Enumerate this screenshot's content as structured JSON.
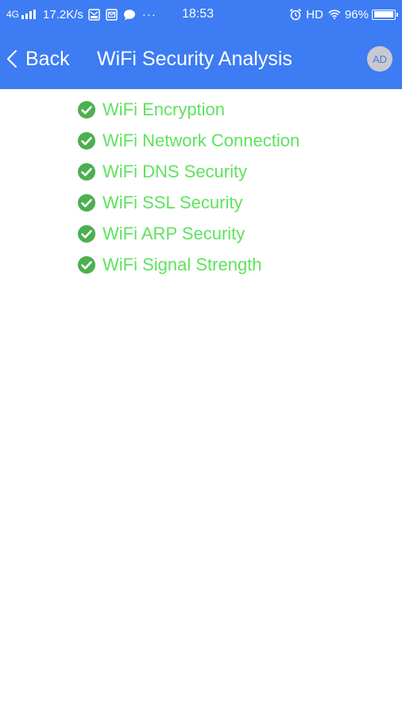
{
  "status_bar": {
    "network": "4G",
    "speed": "17.2K/s",
    "more": "···",
    "time": "18:53",
    "hd": "HD",
    "battery": "96%",
    "battery_level": 0.96
  },
  "header": {
    "back_label": "Back",
    "title": "WiFi Security Analysis",
    "ad_badge": "AD"
  },
  "checks": [
    {
      "label": "WiFi Encryption"
    },
    {
      "label": "WiFi Network Connection"
    },
    {
      "label": "WiFi DNS Security"
    },
    {
      "label": "WiFi SSL Security"
    },
    {
      "label": "WiFi ARP Security"
    },
    {
      "label": "WiFi Signal Strength"
    }
  ],
  "colors": {
    "header_bg": "#3d7cf3",
    "check_green": "#4caf50",
    "label_green": "#5ee35e"
  }
}
